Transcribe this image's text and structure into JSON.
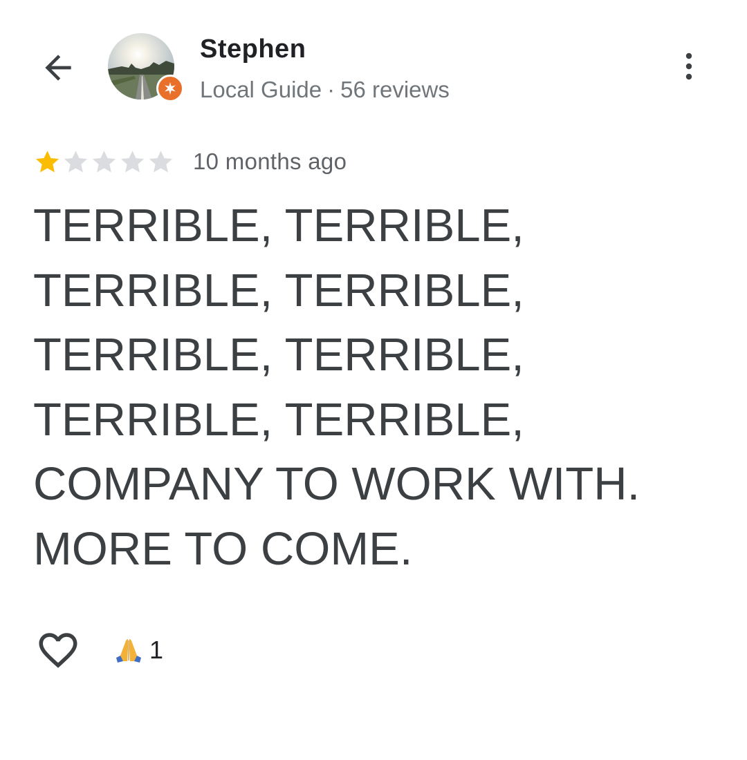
{
  "header": {
    "back_icon": "arrow-back-icon",
    "more_icon": "more-vert-icon"
  },
  "reviewer": {
    "name": "Stephen",
    "badge_icon": "local-guide-star-icon",
    "badge_color": "#e8702a",
    "level": "Local Guide",
    "separator": "·",
    "reviews": "56 reviews"
  },
  "review": {
    "rating": 1,
    "max_rating": 5,
    "star_filled_color": "#fbbc04",
    "star_empty_color": "#dadce0",
    "time": "10 months ago",
    "text_lines": [
      "TERRIBLE, TERRIBLE,",
      "TERRIBLE, TERRIBLE,",
      "TERRIBLE, TERRIBLE,",
      "TERRIBLE, TERRIBLE,",
      "COMPANY TO WORK WITH.",
      "MORE TO COME."
    ]
  },
  "actions": {
    "like_icon": "heart-outline-icon",
    "reaction_icon": "folded-hands-emoji",
    "reaction_emoji": "🙏",
    "reaction_count": "1"
  }
}
